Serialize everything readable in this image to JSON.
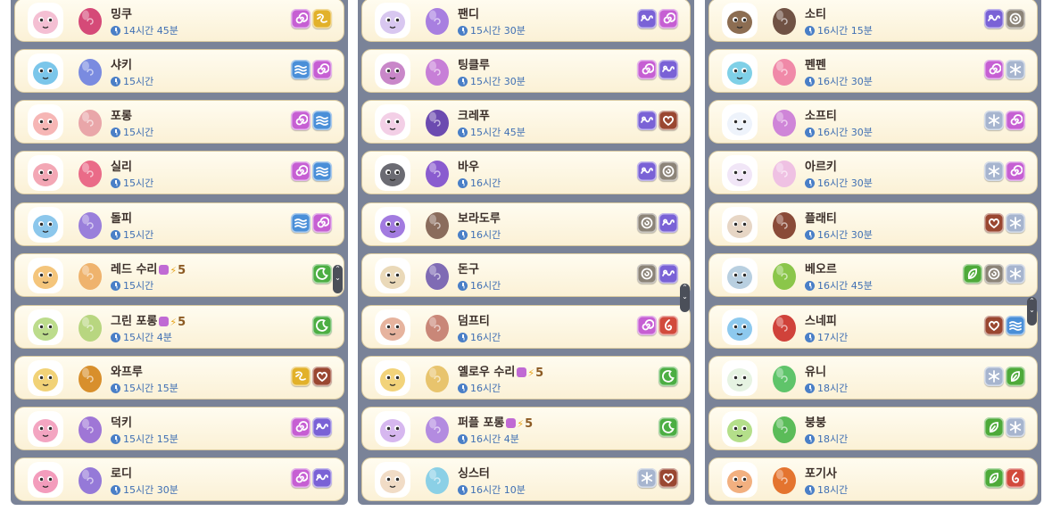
{
  "columns": [
    [
      {
        "name": "밍쿠",
        "time": "14시간 45분",
        "plus": "",
        "elements": [
          "spiral",
          "swirl"
        ],
        "colors": {
          "avatar": "#f4bfd3",
          "egg": "#d54a78"
        }
      },
      {
        "name": "샤키",
        "time": "15시간",
        "plus": "",
        "elements": [
          "water",
          "spiral"
        ],
        "colors": {
          "avatar": "#7bc6ea",
          "egg": "#7a8be0"
        }
      },
      {
        "name": "포롱",
        "time": "15시간",
        "plus": "",
        "elements": [
          "spiral",
          "water"
        ],
        "colors": {
          "avatar": "#f6b6b5",
          "egg": "#e9a6a9"
        }
      },
      {
        "name": "실리",
        "time": "15시간",
        "plus": "",
        "elements": [
          "spiral",
          "water"
        ],
        "colors": {
          "avatar": "#f3a7b5",
          "egg": "#ea6b88"
        }
      },
      {
        "name": "돌피",
        "time": "15시간",
        "plus": "",
        "elements": [
          "water",
          "spiral"
        ],
        "colors": {
          "avatar": "#8cc7ec",
          "egg": "#9a7fdb"
        }
      },
      {
        "name": "레드 수리",
        "time": "15시간",
        "plus": "5",
        "elements": [
          "moon"
        ],
        "colors": {
          "avatar": "#f4c57c",
          "egg": "#efb36d"
        }
      },
      {
        "name": "그린 포롱",
        "time": "15시간 4분",
        "plus": "5",
        "elements": [
          "moon"
        ],
        "colors": {
          "avatar": "#bcdc8c",
          "egg": "#b8d680"
        }
      },
      {
        "name": "와프루",
        "time": "15시간 15분",
        "plus": "",
        "elements": [
          "swirl",
          "heart"
        ],
        "colors": {
          "avatar": "#f1d277",
          "egg": "#d88f2c"
        }
      },
      {
        "name": "덕키",
        "time": "15시간 15분",
        "plus": "",
        "elements": [
          "spiral",
          "wind"
        ],
        "colors": {
          "avatar": "#f3a5c1",
          "egg": "#9f76d6"
        }
      },
      {
        "name": "로디",
        "time": "15시간 30분",
        "plus": "",
        "elements": [
          "spiral",
          "wind"
        ],
        "colors": {
          "avatar": "#f39cbc",
          "egg": "#9579d8"
        }
      }
    ],
    [
      {
        "name": "팬디",
        "time": "15시간 30분",
        "plus": "",
        "elements": [
          "wind",
          "spiral"
        ],
        "colors": {
          "avatar": "#d8c7f0",
          "egg": "#a87fe0"
        }
      },
      {
        "name": "팅클루",
        "time": "15시간 30분",
        "plus": "",
        "elements": [
          "spiral",
          "wind"
        ],
        "colors": {
          "avatar": "#c987c9",
          "egg": "#c77fd7"
        }
      },
      {
        "name": "크레푸",
        "time": "15시간 45분",
        "plus": "",
        "elements": [
          "wind",
          "heart"
        ],
        "colors": {
          "avatar": "#f3cfe6",
          "egg": "#6c4bb0"
        }
      },
      {
        "name": "바우",
        "time": "16시간",
        "plus": "",
        "elements": [
          "wind",
          "stone"
        ],
        "colors": {
          "avatar": "#6b6b73",
          "egg": "#8a5ccf"
        }
      },
      {
        "name": "보라도루",
        "time": "16시간",
        "plus": "",
        "elements": [
          "stone",
          "wind"
        ],
        "colors": {
          "avatar": "#a27be0",
          "egg": "#8a6c5c"
        }
      },
      {
        "name": "돈구",
        "time": "16시간",
        "plus": "",
        "elements": [
          "stone",
          "wind"
        ],
        "colors": {
          "avatar": "#ead9b9",
          "egg": "#7f6bb4"
        }
      },
      {
        "name": "덤프티",
        "time": "16시간",
        "plus": "",
        "elements": [
          "spiral",
          "fire"
        ],
        "colors": {
          "avatar": "#e6b39e",
          "egg": "#c98778"
        }
      },
      {
        "name": "옐로우 수리",
        "time": "16시간",
        "plus": "5",
        "elements": [
          "moon"
        ],
        "colors": {
          "avatar": "#f2d37a",
          "egg": "#e8c46d"
        }
      },
      {
        "name": "퍼플 포롱",
        "time": "16시간 4분",
        "plus": "5",
        "elements": [
          "moon"
        ],
        "colors": {
          "avatar": "#d6b7ef",
          "egg": "#b38be0"
        }
      },
      {
        "name": "싱스터",
        "time": "16시간 10분",
        "plus": "",
        "elements": [
          "frost",
          "heart"
        ],
        "colors": {
          "avatar": "#f1dcc6",
          "egg": "#8bd0e6"
        }
      }
    ],
    [
      {
        "name": "소티",
        "time": "16시간 15분",
        "plus": "",
        "elements": [
          "wind",
          "stone"
        ],
        "colors": {
          "avatar": "#8c6d52",
          "egg": "#705244"
        }
      },
      {
        "name": "펜펜",
        "time": "16시간 30분",
        "plus": "",
        "elements": [
          "spiral",
          "frost"
        ],
        "colors": {
          "avatar": "#7fd0e7",
          "egg": "#f089a8"
        }
      },
      {
        "name": "소프티",
        "time": "16시간 30분",
        "plus": "",
        "elements": [
          "frost",
          "spiral"
        ],
        "colors": {
          "avatar": "#eef3fb",
          "egg": "#cf85d8"
        }
      },
      {
        "name": "아르키",
        "time": "16시간 30분",
        "plus": "",
        "elements": [
          "frost",
          "spiral"
        ],
        "colors": {
          "avatar": "#f1e6f7",
          "egg": "#efc1e3"
        }
      },
      {
        "name": "플래티",
        "time": "16시간 30분",
        "plus": "",
        "elements": [
          "heart",
          "frost"
        ],
        "colors": {
          "avatar": "#e7d6c5",
          "egg": "#8a4b38"
        }
      },
      {
        "name": "베오르",
        "time": "16시간 45분",
        "plus": "",
        "elements": [
          "leaf",
          "stone",
          "frost"
        ],
        "colors": {
          "avatar": "#b8cfe0",
          "egg": "#8bc64a"
        }
      },
      {
        "name": "스네피",
        "time": "17시간",
        "plus": "",
        "elements": [
          "heart",
          "water"
        ],
        "colors": {
          "avatar": "#8dc9ee",
          "egg": "#d0423a"
        }
      },
      {
        "name": "유니",
        "time": "18시간",
        "plus": "",
        "elements": [
          "frost",
          "leaf"
        ],
        "colors": {
          "avatar": "#e6f3e2",
          "egg": "#5fc46a"
        }
      },
      {
        "name": "붕붕",
        "time": "18시간",
        "plus": "",
        "elements": [
          "leaf",
          "frost"
        ],
        "colors": {
          "avatar": "#b4df8a",
          "egg": "#5bbc59"
        }
      },
      {
        "name": "포기사",
        "time": "18시간",
        "plus": "",
        "elements": [
          "leaf",
          "fire"
        ],
        "colors": {
          "avatar": "#f2b080",
          "egg": "#e4742f"
        }
      }
    ]
  ],
  "element_colors": {
    "spiral": "#c65fd3",
    "swirl": "#e2b12a",
    "water": "#4a8fd8",
    "moon": "#4cae43",
    "heart": "#9a4731",
    "wind": "#7a62d6",
    "stone": "#8c8478",
    "fire": "#d24a3c",
    "frost": "#a7b5cf",
    "leaf": "#4eaa3a"
  }
}
